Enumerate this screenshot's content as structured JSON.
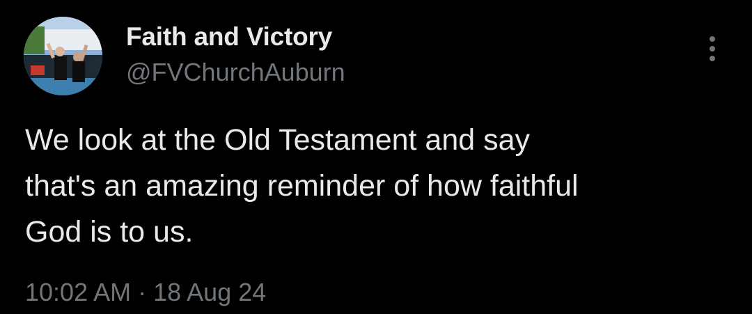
{
  "tweet": {
    "author": {
      "display_name": "Faith and Victory",
      "handle": "@FVChurchAuburn",
      "avatar_icon": "avatar-photo"
    },
    "more_icon": "more-vertical-icon",
    "text": "We look at the Old Testament and say\nthat's an amazing reminder of how faithful\nGod is to us.",
    "time": "10:02 AM",
    "separator": "·",
    "date": "18 Aug 24"
  },
  "colors": {
    "background": "#000000",
    "primary_text": "#e7e9ea",
    "secondary_text": "#71767b"
  }
}
